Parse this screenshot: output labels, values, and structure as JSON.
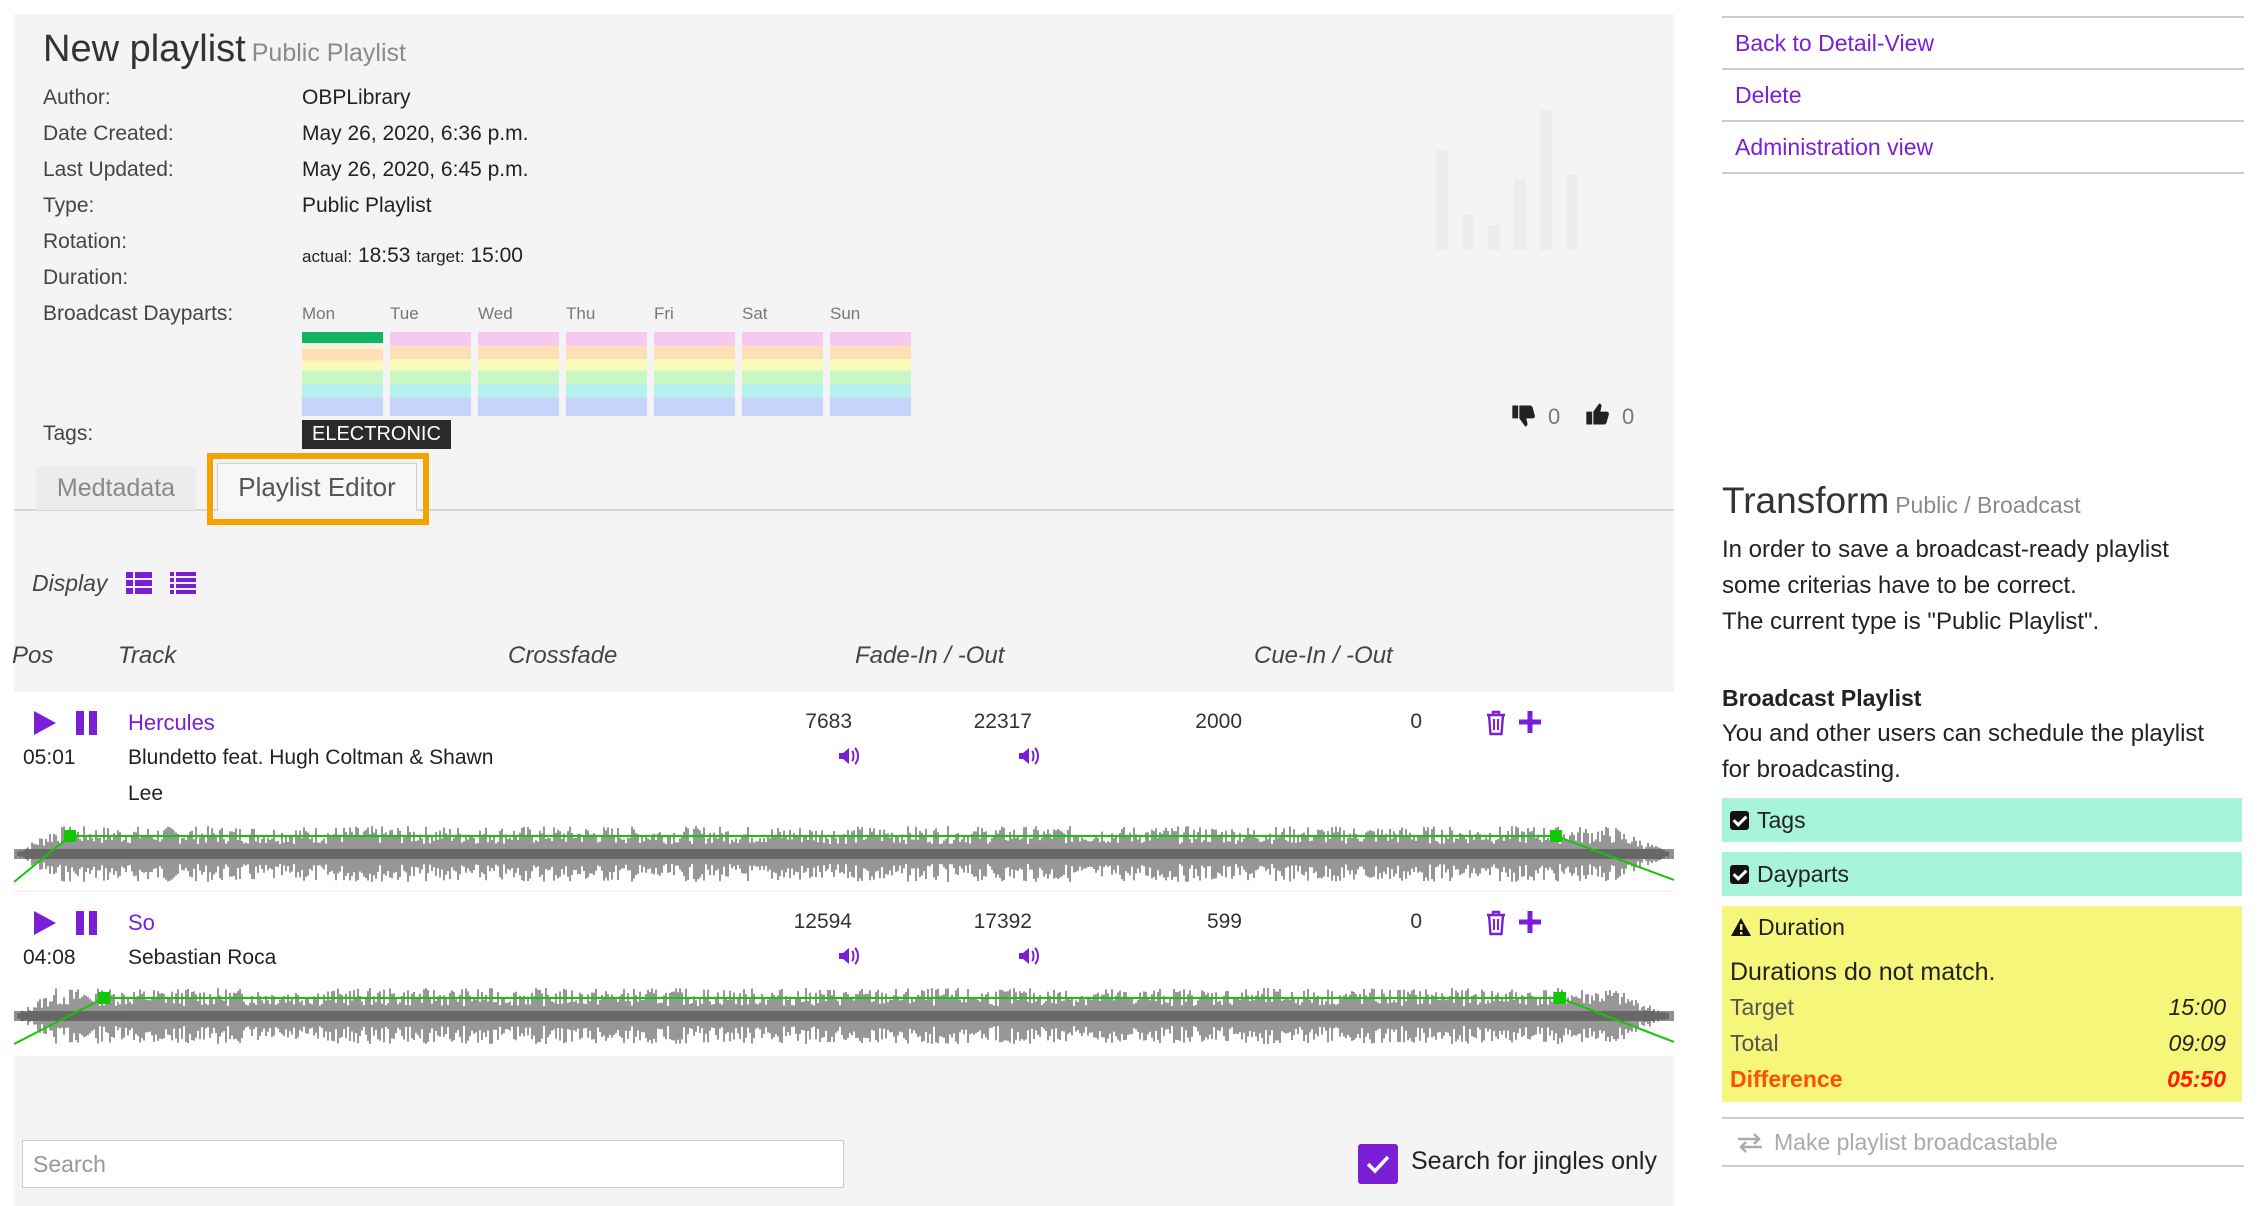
{
  "header": {
    "title": "New playlist",
    "subtitle": "Public Playlist"
  },
  "meta": {
    "author_label": "Author:",
    "author": "OBPLibrary",
    "created_label": "Date Created:",
    "created": "May 26, 2020, 6:36 p.m.",
    "updated_label": "Last Updated:",
    "updated": "May 26, 2020, 6:45 p.m.",
    "type_label": "Type:",
    "type": "Public Playlist",
    "rotation_label": "Rotation:",
    "duration_label": "Duration:",
    "actual_label": "actual:",
    "actual": "18:53",
    "target_label": "target:",
    "target": "15:00",
    "dayparts_label": "Broadcast Dayparts:",
    "days": [
      "Mon",
      "Tue",
      "Wed",
      "Thu",
      "Fri",
      "Sat",
      "Sun"
    ],
    "tags_label": "Tags:",
    "tag": "ELECTRONIC"
  },
  "votes": {
    "down": "0",
    "up": "0"
  },
  "tabs": {
    "metadata": "Medtadata",
    "editor": "Playlist Editor"
  },
  "display_label": "Display",
  "columns": {
    "pos": "Pos",
    "track": "Track",
    "crossfade": "Crossfade",
    "fade": "Fade-In / -Out",
    "cue": "Cue-In / -Out"
  },
  "tracks": [
    {
      "title": "Hercules",
      "artist_line1": "Blundetto feat. Hugh Coltman & Shawn",
      "artist_line2": "Lee",
      "duration": "05:01",
      "fade_in": "7683",
      "fade_out": "22317",
      "cue_in": "2000",
      "cue_out": "0"
    },
    {
      "title": "So",
      "artist_line1": "Sebastian Roca",
      "artist_line2": "",
      "duration": "04:08",
      "fade_in": "12594",
      "fade_out": "17392",
      "cue_in": "599",
      "cue_out": "0"
    }
  ],
  "search": {
    "placeholder": "Search",
    "jingles_label": "Search for jingles only"
  },
  "sidebar": {
    "links": [
      "Back to Detail-View",
      "Delete",
      "Administration view"
    ],
    "transform_title": "Transform",
    "transform_sub": "Public / Broadcast",
    "intro1": "In order to save a broadcast-ready playlist",
    "intro2": "some criterias have to be correct.",
    "intro3": "The current type is \"Public Playlist\".",
    "broadcast_title": "Broadcast Playlist",
    "broadcast_text1": "You and other users can schedule the playlist",
    "broadcast_text2": "for broadcasting.",
    "crit_tags": "Tags",
    "crit_dayparts": "Dayparts",
    "crit_duration": "Duration",
    "dur_msg": "Durations do not match.",
    "target_label": "Target",
    "target": "15:00",
    "total_label": "Total",
    "total": "09:09",
    "diff_label": "Difference",
    "diff": "05:50",
    "make_btn": "Make playlist broadcastable"
  },
  "colors": {
    "accent": "#7a1fd6",
    "highlight": "#f5a300",
    "ok": "#a7f3dc",
    "warn": "#f6f77a",
    "diff": "#ff4f00"
  }
}
